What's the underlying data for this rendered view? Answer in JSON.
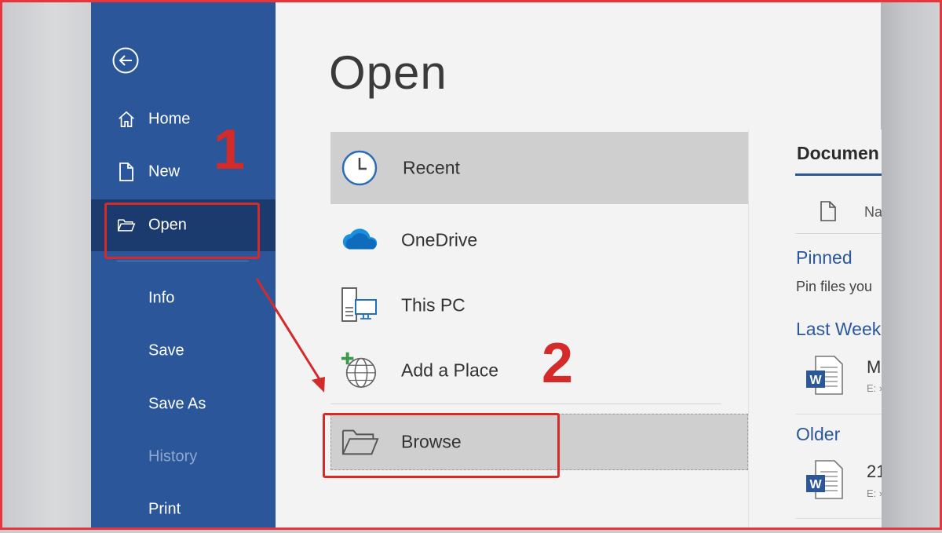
{
  "sidebar": {
    "items": [
      {
        "label": "Home"
      },
      {
        "label": "New"
      },
      {
        "label": "Open"
      },
      {
        "label": "Info"
      },
      {
        "label": "Save"
      },
      {
        "label": "Save As"
      },
      {
        "label": "History"
      },
      {
        "label": "Print"
      }
    ]
  },
  "main": {
    "title": "Open",
    "locations": [
      {
        "label": "Recent"
      },
      {
        "label": "OneDrive"
      },
      {
        "label": "This PC"
      },
      {
        "label": "Add a Place"
      },
      {
        "label": "Browse"
      }
    ],
    "right": {
      "tab": "Documen",
      "column_name": "Na",
      "pinned": "Pinned",
      "pinned_hint": "Pin files you",
      "last_week": "Last Week",
      "doc1_name": "M",
      "doc1_path": "E: »",
      "older": "Older",
      "doc2_name": "21",
      "doc2_path": "E: »"
    }
  },
  "annotations": {
    "step1": "1",
    "step2": "2"
  },
  "colors": {
    "sidebar": "#2b579a",
    "sidebar_active": "#1b3a6e",
    "accent": "#2b579a",
    "annotation": "#d42a2a"
  }
}
